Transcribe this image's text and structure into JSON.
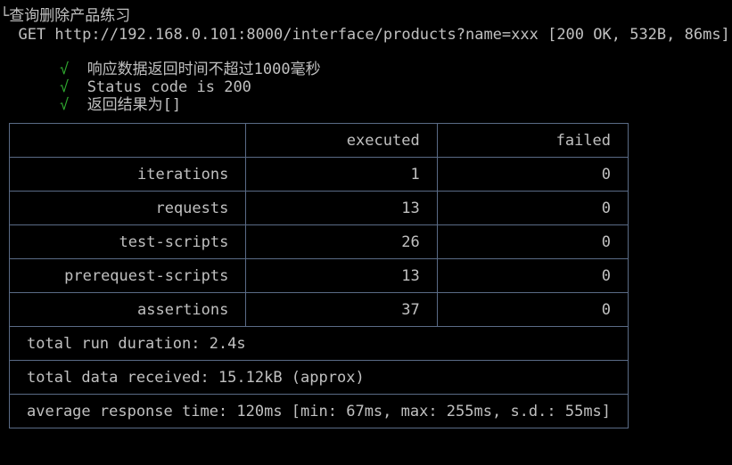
{
  "request": {
    "name": "└查询删除产品练习",
    "line": "  GET http://192.168.0.101:8000/interface/products?name=xxx [200 OK, 532B, 86ms]"
  },
  "assertions": [
    {
      "mark": "√",
      "text": "响应数据返回时间不超过1000毫秒"
    },
    {
      "mark": "√",
      "text": "Status code is 200"
    },
    {
      "mark": "√",
      "text": "返回结果为[]"
    }
  ],
  "summary": {
    "headers": [
      "",
      "executed",
      "failed"
    ],
    "rows": [
      {
        "label": "iterations",
        "executed": "1",
        "failed": "0"
      },
      {
        "label": "requests",
        "executed": "13",
        "failed": "0"
      },
      {
        "label": "test-scripts",
        "executed": "26",
        "failed": "0"
      },
      {
        "label": "prerequest-scripts",
        "executed": "13",
        "failed": "0"
      },
      {
        "label": "assertions",
        "executed": "37",
        "failed": "0"
      }
    ],
    "total_run_duration": "total run duration: 2.4s",
    "total_data_received": "total data received: 15.12kB (approx)",
    "average_response_time": "average response time: 120ms [min: 67ms, max: 255ms, s.d.: 55ms]"
  },
  "colors": {
    "background": "#000000",
    "text": "#c0c0c0",
    "pass": "#2ea52e",
    "border": "#5a6b86"
  }
}
